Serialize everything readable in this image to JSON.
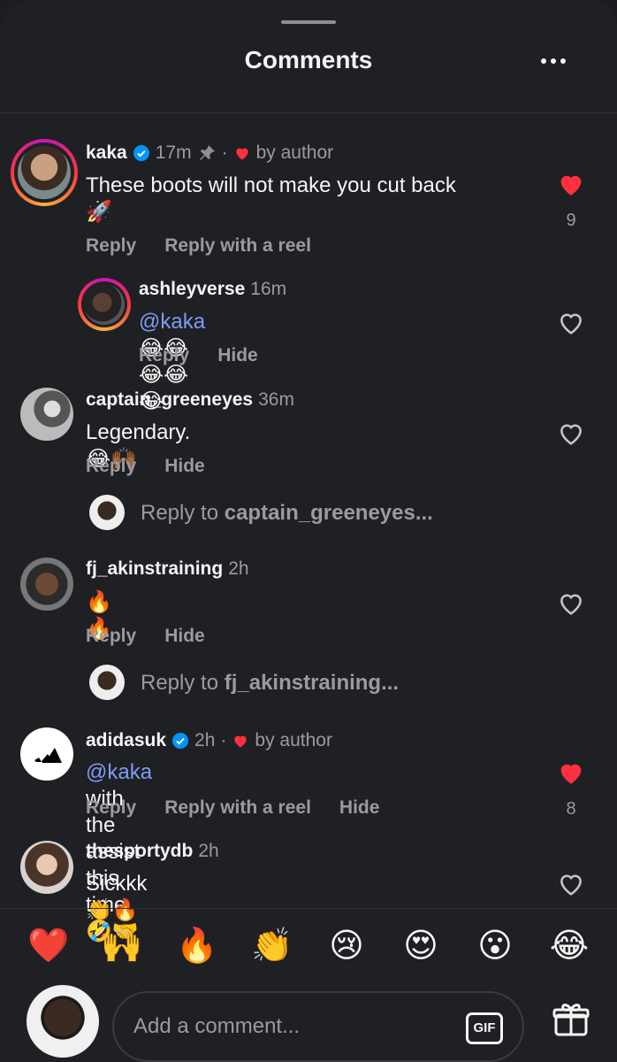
{
  "header": {
    "title": "Comments"
  },
  "comments": [
    {
      "username": "kaka",
      "time": "17m",
      "author_tag": "by author",
      "text": "These boots will not make you cut back",
      "text_emoji": "🚀",
      "actions": [
        "Reply",
        "Reply with a reel"
      ],
      "likes": "9",
      "liked": true
    },
    {
      "username": "ashleyverse",
      "time": "16m",
      "mention": "@kaka",
      "text": "😂😂😂😂😂",
      "actions": [
        "Reply",
        "Hide"
      ],
      "liked": false
    },
    {
      "username": "captain_greeneyes",
      "time": "36m",
      "text": "Legendary. 😂🙌🏾",
      "actions": [
        "Reply",
        "Hide"
      ],
      "liked": false,
      "reply_prompt": "Reply to ",
      "reply_target": "captain_greeneyes..."
    },
    {
      "username": "fj_akinstraining",
      "time": "2h",
      "text": "🔥🔥",
      "actions": [
        "Reply",
        "Hide"
      ],
      "liked": false,
      "reply_prompt": "Reply to ",
      "reply_target": "fj_akinstraining..."
    },
    {
      "username": "adidasuk",
      "time": "2h",
      "author_tag": "by author",
      "mention": "@kaka",
      "text": " with the assist this time 🤣🤝",
      "actions": [
        "Reply",
        "Reply with a reel",
        "Hide"
      ],
      "likes": "8",
      "liked": true
    },
    {
      "username": "thesportydb",
      "time": "2h",
      "text": "Sickkk 👏🔥",
      "actions": [],
      "liked": false
    }
  ],
  "quick_emojis": [
    "❤️",
    "🙌",
    "🔥",
    "👏",
    "😢",
    "😍",
    "😮",
    "😂"
  ],
  "compose": {
    "placeholder": "Add a comment...",
    "gif_label": "GIF"
  },
  "colors": {
    "background": "#1f2024",
    "like_red": "#ff3040",
    "verified_blue": "#0095f6",
    "mention_blue": "#7d9cf5"
  }
}
